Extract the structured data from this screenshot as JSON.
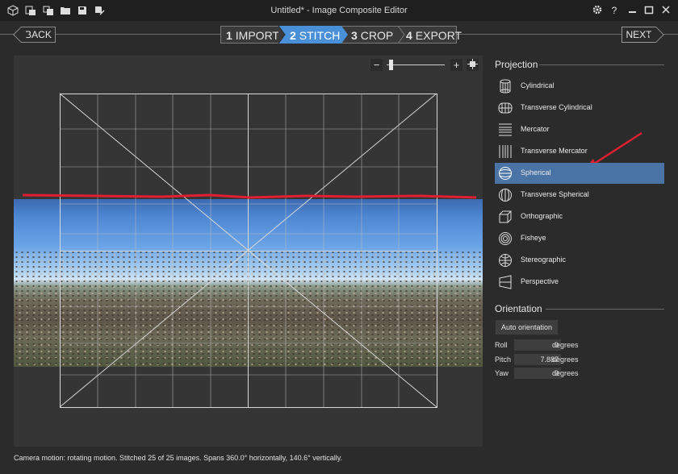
{
  "window": {
    "title": "Untitled* - Image Composite Editor",
    "toolbar_icons": [
      "app-cube-icon",
      "new-panorama-icon",
      "new-from-video-icon",
      "open-folder-icon",
      "save-icon",
      "save-as-icon"
    ],
    "window_controls": [
      "settings-gear-icon",
      "help-icon",
      "minimize-icon",
      "maximize-icon",
      "close-icon"
    ]
  },
  "nav": {
    "back_label": "BACK",
    "next_label": "NEXT",
    "steps": [
      {
        "num": "1",
        "label": "IMPORT"
      },
      {
        "num": "2",
        "label": "STITCH"
      },
      {
        "num": "3",
        "label": "CROP"
      },
      {
        "num": "4",
        "label": "EXPORT"
      }
    ],
    "active_step": 1
  },
  "zoom": {
    "minus": "−",
    "plus": "+",
    "level": 0.05
  },
  "status": {
    "text": "Camera motion: rotating motion. Stitched 25 of 25 images. Spans 360.0° horizontally, 140.6° vertically."
  },
  "projection": {
    "title": "Projection",
    "items": [
      {
        "label": "Cylindrical",
        "icon": "cylindrical-icon"
      },
      {
        "label": "Transverse Cylindrical",
        "icon": "transverse-cylindrical-icon"
      },
      {
        "label": "Mercator",
        "icon": "mercator-icon"
      },
      {
        "label": "Transverse Mercator",
        "icon": "transverse-mercator-icon"
      },
      {
        "label": "Spherical",
        "icon": "spherical-icon"
      },
      {
        "label": "Transverse Spherical",
        "icon": "transverse-spherical-icon"
      },
      {
        "label": "Orthographic",
        "icon": "orthographic-icon"
      },
      {
        "label": "Fisheye",
        "icon": "fisheye-icon"
      },
      {
        "label": "Stereographic",
        "icon": "stereographic-icon"
      },
      {
        "label": "Perspective",
        "icon": "perspective-icon"
      }
    ],
    "selected": "Spherical"
  },
  "orientation": {
    "title": "Orientation",
    "auto_label": "Auto orientation",
    "roll_label": "Roll",
    "roll_value": "0",
    "roll_unit": "degrees",
    "pitch_label": "Pitch",
    "pitch_value": "7.887",
    "pitch_unit": "degrees",
    "yaw_label": "Yaw",
    "yaw_value": "0",
    "yaw_unit": "degrees"
  },
  "colors": {
    "accent": "#4a90d9",
    "selected_item": "#4a73a6",
    "annotation": "#e02030"
  }
}
